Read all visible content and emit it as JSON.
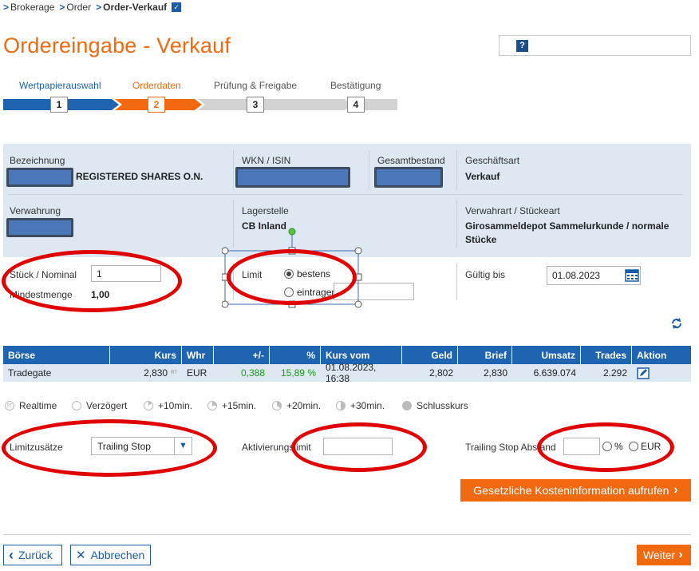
{
  "breadcrumb": {
    "items": [
      "Brokerage",
      "Order",
      "Order-Verkauf"
    ]
  },
  "page": {
    "title": "Ordereingabe - Verkauf",
    "help": "?"
  },
  "steps": [
    {
      "label": "Wertpapierauswahl",
      "num": "1",
      "color": "#1f64b0"
    },
    {
      "label": "Orderdaten",
      "num": "2",
      "color": "#f26a10"
    },
    {
      "label": "Prüfung & Freigabe",
      "num": "3",
      "color": "#d2d2d2"
    },
    {
      "label": "Bestätigung",
      "num": "4",
      "color": "#d2d2d2"
    }
  ],
  "info": {
    "bezeichnung_label": "Bezeichnung",
    "bezeichnung_value": "REGISTERED SHARES O.N.",
    "wkn_label": "WKN / ISIN",
    "gesamtbestand_label": "Gesamtbestand",
    "geschaeftsart_label": "Geschäftsart",
    "geschaeftsart_value": "Verkauf",
    "verwahrung_label": "Verwahrung",
    "lagerstelle_label": "Lagerstelle",
    "lagerstelle_value": "CB Inland",
    "verwahrart_label": "Verwahrart / Stückeart",
    "verwahrart_value_1": "Girosammeldepot Sammelurkunde / normale",
    "verwahrart_value_2": "Stücke"
  },
  "order": {
    "stueck_label": "Stück / Nominal",
    "stueck_value": "1",
    "mindestmenge_label": "Mindestmenge",
    "mindestmenge_value": "1,00",
    "limit_label": "Limit",
    "limit_option_1": "bestens",
    "limit_option_2": "eintragen",
    "gueltig_label": "Gültig bis",
    "gueltig_value": "01.08.2023"
  },
  "table": {
    "headers": [
      "Börse",
      "Kurs",
      "Whr",
      "+/-",
      "%",
      "Kurs vom",
      "Geld",
      "Brief",
      "Umsatz",
      "Trades",
      "Aktion"
    ],
    "row": {
      "boerse": "Tradegate",
      "kurs": "2,830",
      "kurs_tag": "RT",
      "whr": "EUR",
      "change": "0,388",
      "pct": "15,89 %",
      "kurs_vom": "01.08.2023, 16:38",
      "geld": "2,802",
      "brief": "2,830",
      "umsatz": "6.639.074",
      "trades": "2.292"
    },
    "positive_color": "#1a9a1a"
  },
  "legend": {
    "items": [
      "Realtime",
      "Verzögert",
      "+10min.",
      "+15min.",
      "+20min.",
      "+30min.",
      "Schlusskurs"
    ],
    "rt_tag": "RT"
  },
  "zusatz": {
    "limitzusaetze_label": "Limitzusätze",
    "limitzusaetze_value": "Trailing Stop",
    "aktivierung_label": "Aktivierungslimit",
    "trailing_label": "Trailing Stop Abstand",
    "unit_pct": "%",
    "unit_eur": "EUR"
  },
  "actions": {
    "kosten": "Gesetzliche Kosteninformation aufrufen",
    "zurueck": "Zurück",
    "abbrechen": "Abbrechen",
    "weiter": "Weiter"
  },
  "colors": {
    "accent": "#f26a10",
    "brand": "#1f64b0",
    "annotation": "#e00000"
  }
}
